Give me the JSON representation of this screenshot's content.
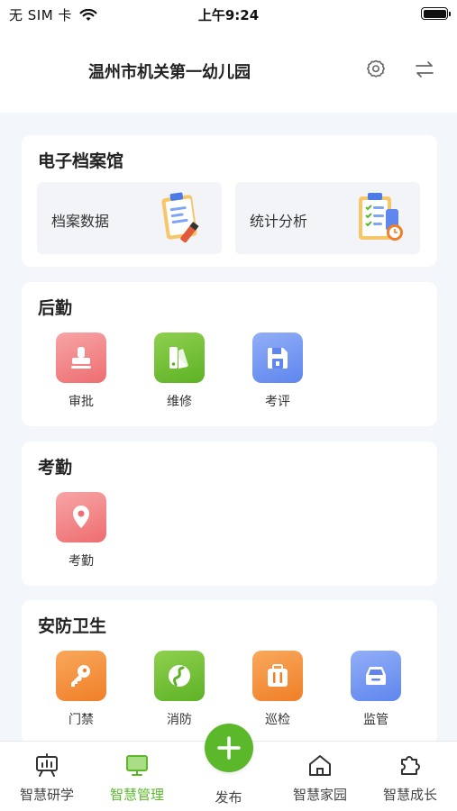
{
  "status_bar": {
    "carrier": "无 SIM 卡",
    "time": "上午9:24"
  },
  "header": {
    "title": "温州市机关第一幼儿园",
    "icons": [
      "settings-icon",
      "switch-icon"
    ]
  },
  "sections": {
    "archive": {
      "title": "电子档案馆",
      "tiles": [
        {
          "label": "档案数据",
          "icon": "clipboard-pencil-illustration"
        },
        {
          "label": "统计分析",
          "icon": "clipboard-checklist-illustration"
        }
      ]
    },
    "logistics": {
      "title": "后勤",
      "items": [
        {
          "label": "审批",
          "icon": "stamp-icon",
          "color": "#ee6d70"
        },
        {
          "label": "维修",
          "icon": "color-swatch-icon",
          "color": "#5db225"
        },
        {
          "label": "考评",
          "icon": "save-document-icon",
          "color": "#5e86ee"
        }
      ]
    },
    "attendance": {
      "title": "考勤",
      "items": [
        {
          "label": "考勤",
          "icon": "location-pin-icon",
          "color": "#ee6d70"
        }
      ]
    },
    "safety": {
      "title": "安防卫生",
      "items": [
        {
          "label": "门禁",
          "icon": "key-icon",
          "color": "#f07f27"
        },
        {
          "label": "消防",
          "icon": "route-icon",
          "color": "#5db225"
        },
        {
          "label": "巡检",
          "icon": "briefcase-icon",
          "color": "#f07f27"
        },
        {
          "label": "监管",
          "icon": "car-icon",
          "color": "#5e86ee"
        }
      ]
    }
  },
  "tabbar": {
    "tabs": [
      {
        "label": "智慧研学",
        "icon": "presentation-board-icon",
        "active": false
      },
      {
        "label": "智慧管理",
        "icon": "monitor-icon",
        "active": true
      },
      {
        "label": "发布",
        "icon": "plus-icon",
        "active": false
      },
      {
        "label": "智慧家园",
        "icon": "home-icon",
        "active": false
      },
      {
        "label": "智慧成长",
        "icon": "puzzle-icon",
        "active": false
      }
    ],
    "active_color": "#5cb82b"
  }
}
